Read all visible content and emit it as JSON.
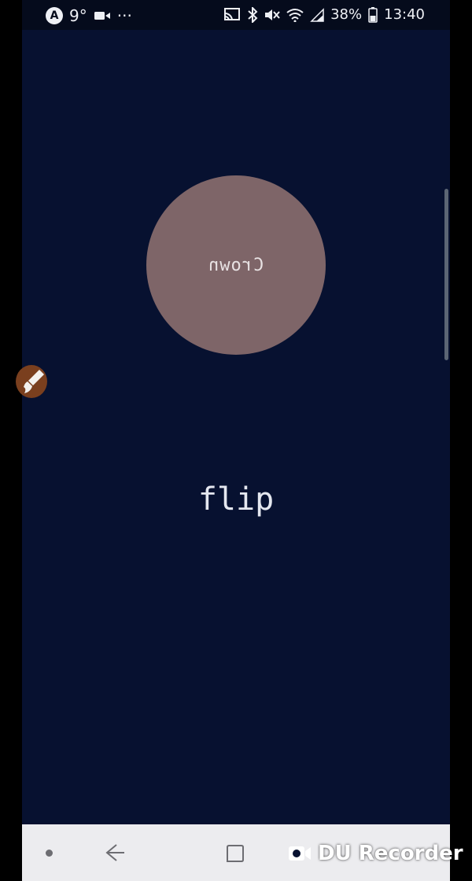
{
  "status_bar": {
    "temperature": "9°",
    "overflow": "···",
    "battery_percent": "38%",
    "time": "13:40",
    "app_badge": "A"
  },
  "app": {
    "circle_text": "Crown",
    "flip_label": "flip",
    "circle_color": "#7e6568",
    "background_color": "#071130"
  },
  "watermark": {
    "text": "DU Recorder"
  }
}
